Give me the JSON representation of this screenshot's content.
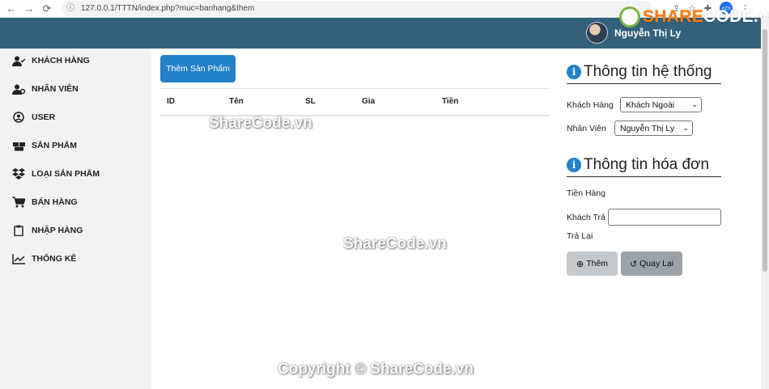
{
  "browser": {
    "url": "127.0.0.1/TTTN/index.php?muc=banhang&them",
    "back_icon": "←",
    "forward_icon": "→",
    "reload_icon": "⟳",
    "lock_icon": "ⓘ"
  },
  "watermark": {
    "logo_share": "SHARE",
    "logo_code": "CODE.vn",
    "text_center_1": "ShareCode.vn",
    "text_center_2": "ShareCode.vn",
    "copyright": "Copyright © ShareCode.vn"
  },
  "header": {
    "user_name": "Nguyễn Thị Ly",
    "bg_color": "#34617a"
  },
  "sidebar": {
    "items": [
      {
        "label": "KHÁCH HÀNG",
        "icon": "user-check-icon",
        "glyph": "👤"
      },
      {
        "label": "NHÂN VIÊN",
        "icon": "user-gear-icon",
        "glyph": "👤"
      },
      {
        "label": "USER",
        "icon": "user-circle-icon",
        "glyph": "◉"
      },
      {
        "label": "SẢN PHẨM",
        "icon": "boxes-icon",
        "glyph": "▣"
      },
      {
        "label": "LOẠI SẢN PHẨM",
        "icon": "dropbox-icon",
        "glyph": "❖"
      },
      {
        "label": "BÁN HÀNG",
        "icon": "cart-icon",
        "glyph": "🛒"
      },
      {
        "label": "NHẬP HÀNG",
        "icon": "clipboard-icon",
        "glyph": "📋"
      },
      {
        "label": "THỐNG KÊ",
        "icon": "chart-line-icon",
        "glyph": "📈"
      }
    ]
  },
  "main": {
    "add_product_label": "Thêm Sản Phẩm",
    "table_headers": [
      "ID",
      "Tên",
      "SL",
      "Gia",
      "Tiền"
    ],
    "accent_color": "#2381c9"
  },
  "system_info": {
    "title": "Thông tin hệ thống",
    "customer_label": "Khách Hàng",
    "customer_value": "Khách Ngoài",
    "employee_label": "Nhân Viên",
    "employee_value": "Nguyễn Thị Ly"
  },
  "invoice": {
    "title": "Thông tin hóa đơn",
    "total_label": "Tiền Hàng",
    "paid_label": "Khách Trả",
    "paid_value": "",
    "change_label": "Trả Lại",
    "add_button": "Thêm",
    "back_button": "Quay Lại"
  }
}
